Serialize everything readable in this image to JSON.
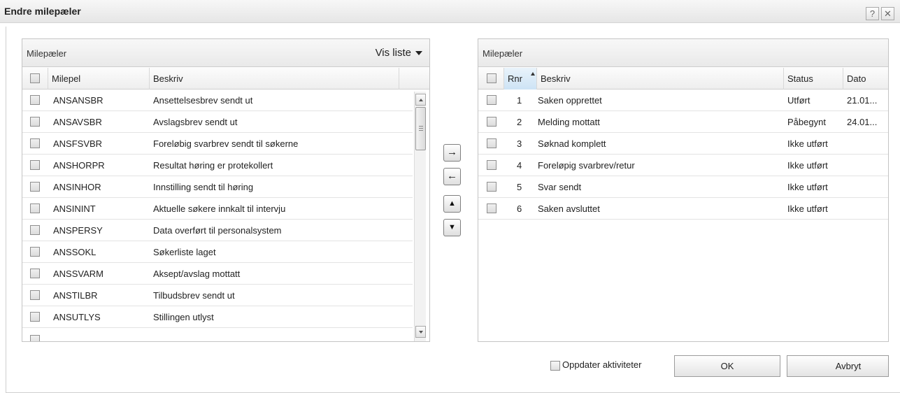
{
  "window": {
    "title": "Endre milepæler",
    "help_glyph": "?",
    "close_glyph": "✕"
  },
  "left_panel": {
    "title": "Milepæler",
    "view_menu_label": "Vis liste",
    "columns": [
      "Milepel",
      "Beskriv"
    ],
    "rows": [
      {
        "code": "ANSANSBR",
        "desc": "Ansettelsesbrev sendt ut"
      },
      {
        "code": "ANSAVSBR",
        "desc": "Avslagsbrev sendt ut"
      },
      {
        "code": "ANSFSVBR",
        "desc": "Foreløbig svarbrev sendt til søkerne"
      },
      {
        "code": "ANSHORPR",
        "desc": "Resultat høring er protekollert"
      },
      {
        "code": "ANSINHOR",
        "desc": "Innstilling sendt til høring"
      },
      {
        "code": "ANSININT",
        "desc": "Aktuelle søkere innkalt til intervju"
      },
      {
        "code": "ANSPERSY",
        "desc": "Data overført til personalsystem"
      },
      {
        "code": "ANSSOKL",
        "desc": "Søkerliste laget"
      },
      {
        "code": "ANSSVARM",
        "desc": "Aksept/avslag mottatt"
      },
      {
        "code": "ANSTILBR",
        "desc": "Tilbudsbrev sendt ut"
      },
      {
        "code": "ANSUTLYS",
        "desc": "Stillingen utlyst"
      }
    ]
  },
  "move_buttons": {
    "right": "→",
    "left": "←",
    "up": "▲",
    "down": "▼"
  },
  "right_panel": {
    "title": "Milepæler",
    "columns": [
      "Rnr",
      "Beskriv",
      "Status",
      "Dato"
    ],
    "rows": [
      {
        "rnr": "1",
        "desc": "Saken opprettet",
        "status": "Utført",
        "date": "21.01..."
      },
      {
        "rnr": "2",
        "desc": "Melding mottatt",
        "status": "Påbegynt",
        "date": "24.01..."
      },
      {
        "rnr": "3",
        "desc": "Søknad komplett",
        "status": "Ikke utført",
        "date": ""
      },
      {
        "rnr": "4",
        "desc": "Foreløpig svarbrev/retur",
        "status": "Ikke utført",
        "date": ""
      },
      {
        "rnr": "5",
        "desc": "Svar sendt",
        "status": "Ikke utført",
        "date": ""
      },
      {
        "rnr": "6",
        "desc": "Saken avsluttet",
        "status": "Ikke utført",
        "date": ""
      }
    ]
  },
  "footer": {
    "update_activities_label": "Oppdater aktiviteter",
    "update_activities_checked": false,
    "ok_label": "OK",
    "cancel_label": "Avbryt"
  }
}
